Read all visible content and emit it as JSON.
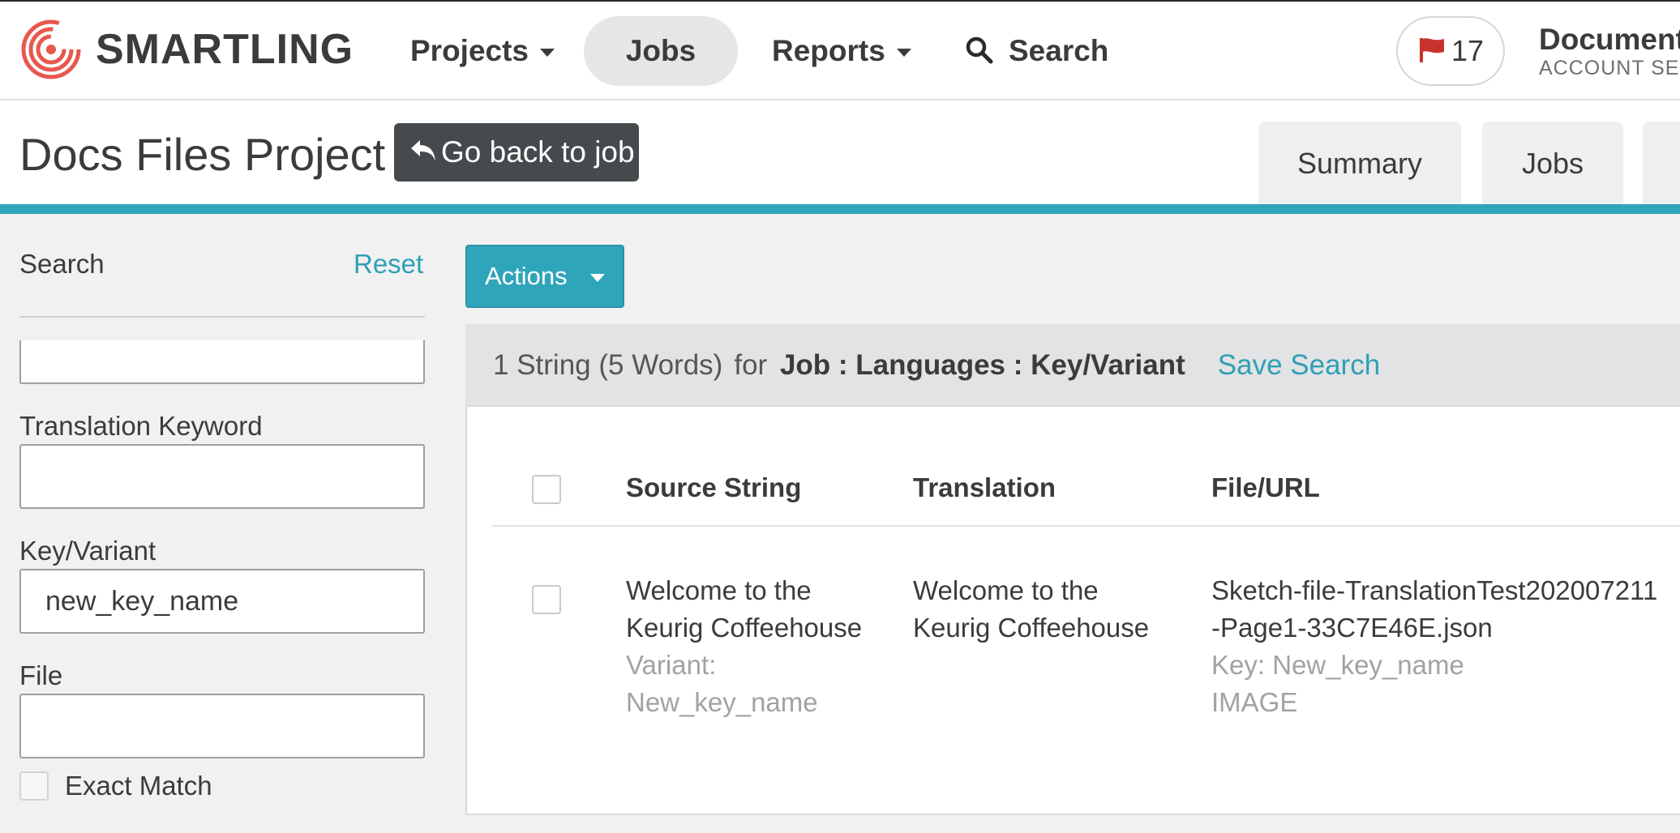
{
  "nav": {
    "brand": "SMARTLING",
    "projects_label": "Projects",
    "jobs_label": "Jobs",
    "reports_label": "Reports",
    "search_label": "Search",
    "flag_count": "17",
    "account_name": "Documentation",
    "account_sub": "ACCOUNT SETTINGS"
  },
  "project": {
    "title": "Docs Files Project",
    "back_label": "Go back to job",
    "tabs": [
      "Summary",
      "Jobs"
    ]
  },
  "sidebar": {
    "title": "Search",
    "reset_label": "Reset",
    "fields": {
      "keyword_label": "Translation Keyword",
      "keyword_value": "",
      "key_label": "Key/Variant",
      "key_value": "new_key_name",
      "file_label": "File",
      "file_value": ""
    },
    "exact_match_label": "Exact Match"
  },
  "main": {
    "actions_label": "Actions",
    "results": {
      "count_text": "1 String (5 Words)",
      "for_text": "for",
      "path_text": "Job : Languages : Key/Variant",
      "save_search_label": "Save Search"
    },
    "table": {
      "headers": {
        "source": "Source String",
        "translation": "Translation",
        "file": "File/URL"
      },
      "rows": [
        {
          "source": "Welcome to the Keurig Coffeehouse",
          "variant": "Variant: New_key_name",
          "translation": "Welcome to the Keurig Coffeehouse",
          "file": "Sketch-file-TranslationTest202007211-Page1-33C7E46E.json",
          "key": "Key: New_key_name",
          "type": "IMAGE"
        }
      ]
    }
  },
  "colors": {
    "accent": "#2fa5bb",
    "link": "#2ea0b6",
    "flag": "#c8322d",
    "logo": "#e8574e",
    "back_button": "#454b4d"
  },
  "icons": {
    "logo": "smartling-logo-icon",
    "search": "search-icon",
    "flag": "flag-icon",
    "back": "back-arrow-icon",
    "dropdown": "chevron-down-icon"
  }
}
